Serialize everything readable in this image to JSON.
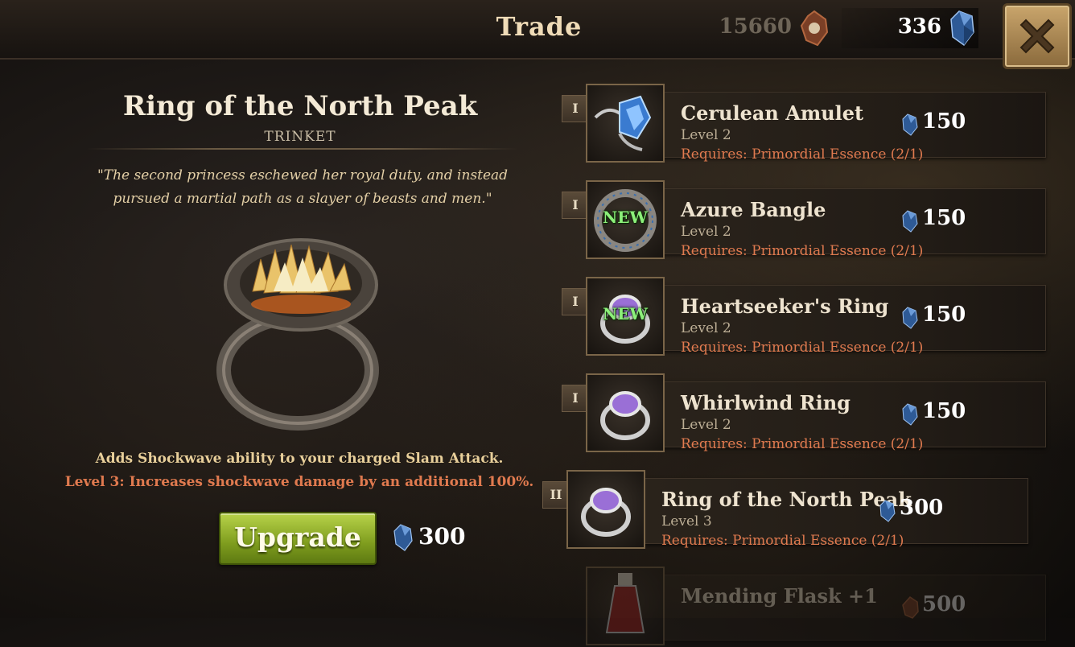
{
  "header": {
    "title": "Trade",
    "gold": "15660",
    "gems": "336"
  },
  "detail": {
    "name": "Ring of the North Peak",
    "type": "TRINKET",
    "lore": "\"The second princess eschewed her royal duty, and instead pursued a martial path as a slayer of beasts and men.\"",
    "description": "Adds Shockwave ability to your charged Slam Attack.",
    "level_effect": "Level 3: Increases shockwave damage by an additional 100%.",
    "upgrade_label": "Upgrade",
    "upgrade_cost": "300"
  },
  "items": [
    {
      "tier": "I",
      "name": "Cerulean Amulet",
      "level": "Level 2",
      "requirement": "Requires: Primordial Essence (2/1)",
      "price": "150",
      "badge": "",
      "icon": "amulet-icon"
    },
    {
      "tier": "I",
      "name": "Azure Bangle",
      "level": "Level 2",
      "requirement": "Requires: Primordial Essence (2/1)",
      "price": "150",
      "badge": "NEW",
      "icon": "bangle-icon"
    },
    {
      "tier": "I",
      "name": "Heartseeker's Ring",
      "level": "Level 2",
      "requirement": "Requires: Primordial Essence (2/1)",
      "price": "150",
      "badge": "NEW",
      "icon": "ring-icon"
    },
    {
      "tier": "I",
      "name": "Whirlwind Ring",
      "level": "Level 2",
      "requirement": "Requires: Primordial Essence (2/1)",
      "price": "150",
      "badge": "",
      "icon": "ring-icon"
    },
    {
      "tier": "II",
      "name": "Ring of the North Peak",
      "level": "Level 3",
      "requirement": "Requires: Primordial Essence (2/1)",
      "price": "300",
      "badge": "",
      "icon": "ring-icon"
    },
    {
      "tier": "",
      "name": "Mending Flask +1",
      "level": "",
      "requirement": "",
      "price": "500",
      "badge": "",
      "icon": "flask-icon"
    }
  ],
  "colors": {
    "accent_orange": "#e07a4f",
    "upgrade_green": "#8fae26",
    "new_badge": "#8cf07a",
    "gem_blue": "#3b6fae"
  }
}
